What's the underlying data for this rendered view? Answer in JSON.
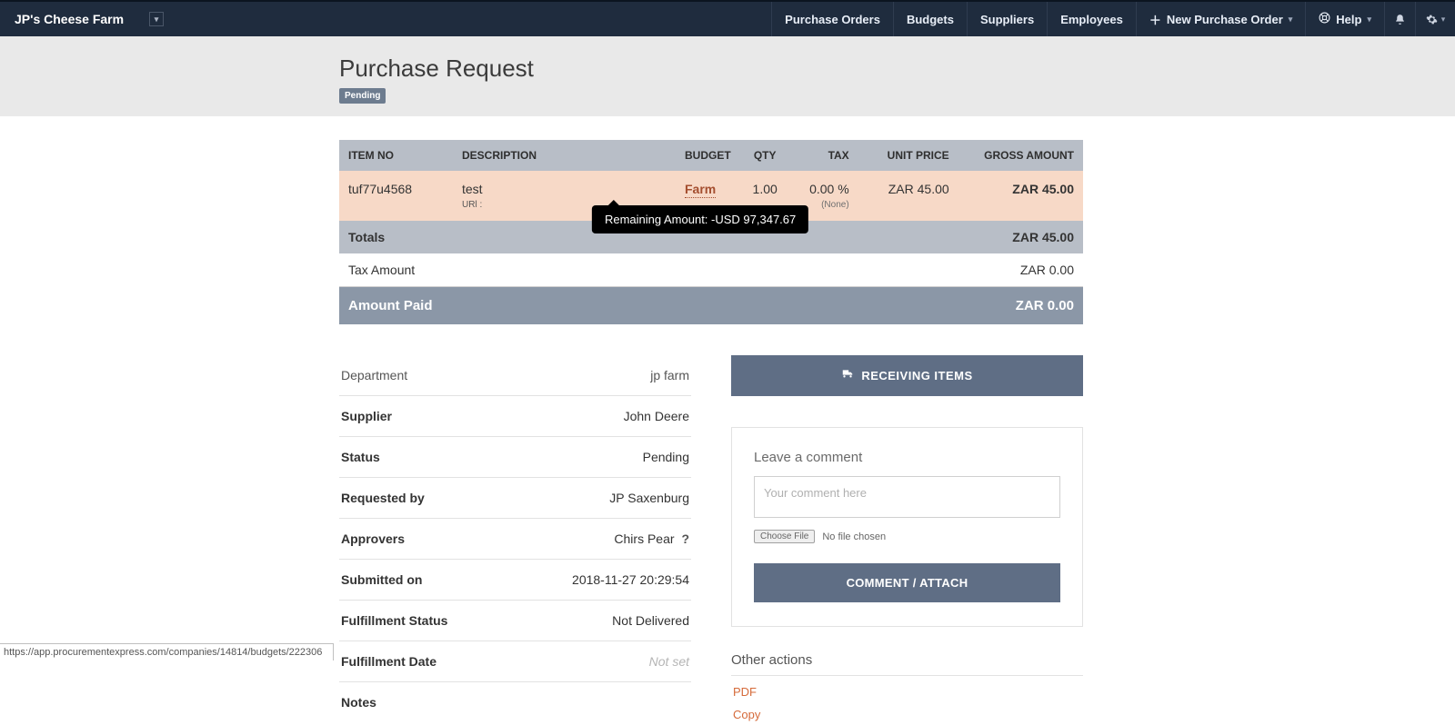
{
  "nav": {
    "company": "JP's Cheese Farm",
    "purchase_orders": "Purchase Orders",
    "budgets": "Budgets",
    "suppliers": "Suppliers",
    "employees": "Employees",
    "new_po": "New Purchase Order",
    "help": "Help"
  },
  "header": {
    "title": "Purchase Request",
    "status": "Pending"
  },
  "table": {
    "headers": {
      "item_no": "ITEM NO",
      "description": "DESCRIPTION",
      "budget": "BUDGET",
      "qty": "QTY",
      "tax": "TAX",
      "unit_price": "UNIT PRICE",
      "gross_amount": "GROSS AMOUNT"
    },
    "line": {
      "item_no": "tuf77u4568",
      "description": "test",
      "description_sub": "URl :",
      "budget": "Farm",
      "qty": "1.00",
      "tax": "0.00 %",
      "tax_sub": "(None)",
      "unit_price": "ZAR 45.00",
      "gross": "ZAR 45.00"
    },
    "tooltip": "Remaining Amount: -USD 97,347.67",
    "totals_label": "Totals",
    "totals_value": "ZAR 45.00",
    "tax_label": "Tax Amount",
    "tax_value": "ZAR 0.00",
    "paid_label": "Amount Paid",
    "paid_value": "ZAR 0.00"
  },
  "details": {
    "department_label": "Department",
    "department_value": "jp farm",
    "supplier_label": "Supplier",
    "supplier_value": "John Deere",
    "status_label": "Status",
    "status_value": "Pending",
    "requested_by_label": "Requested by",
    "requested_by_value": "JP Saxenburg",
    "approvers_label": "Approvers",
    "approvers_value": "Chirs Pear",
    "submitted_label": "Submitted on",
    "submitted_value": "2018-11-27 20:29:54",
    "fulfillment_status_label": "Fulfillment Status",
    "fulfillment_status_value": "Not Delivered",
    "fulfillment_date_label": "Fulfillment Date",
    "fulfillment_date_value": "Not set",
    "notes_label": "Notes"
  },
  "right": {
    "receiving": "RECEIVING ITEMS",
    "leave_comment": "Leave a comment",
    "comment_placeholder": "Your comment here",
    "choose_file": "Choose File",
    "no_file": "No file chosen",
    "comment_attach": "COMMENT / ATTACH",
    "other_actions": "Other actions",
    "pdf": "PDF",
    "copy": "Copy"
  },
  "footer_url": "https://app.procurementexpress.com/companies/14814/budgets/222306"
}
